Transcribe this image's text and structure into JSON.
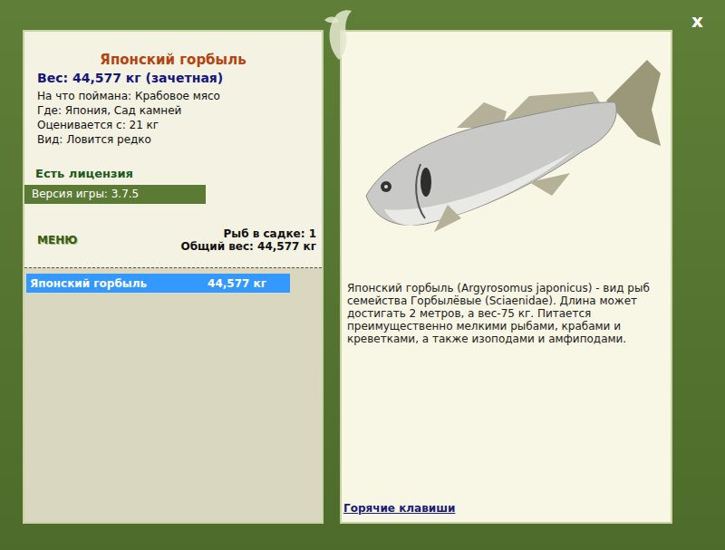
{
  "window": {
    "close": "x"
  },
  "fish": {
    "title": "Японский горбыль",
    "weight": "Вес: 44,577 кг (зачетная)",
    "details": [
      "На что поймана: Крабовое мясо",
      "Где: Япония, Сад камней",
      "Оценивается с: 21 кг",
      "Вид: Ловится редко"
    ],
    "license": "Есть лицензия",
    "description": "Японский горбыль (Argyrosomus japonicus) - вид рыб семейства Горбылёвые (Sciaenidae). Длина может достигать 2 метров, а вес-75 кг. Питается преимущественно мелкими рыбами, крабами и креветками, а также изоподами и амфиподами."
  },
  "version": "Версия игры: 3.7.5",
  "menu": "МЕНЮ",
  "keepnet": {
    "count": "Рыб в садке: 1",
    "total": "Общий вес: 44,577 кг",
    "items": [
      {
        "name": "Японский горбыль",
        "weight": "44,577 кг",
        "selected": true
      }
    ]
  },
  "hotkeys": "Горячие клавиши"
}
